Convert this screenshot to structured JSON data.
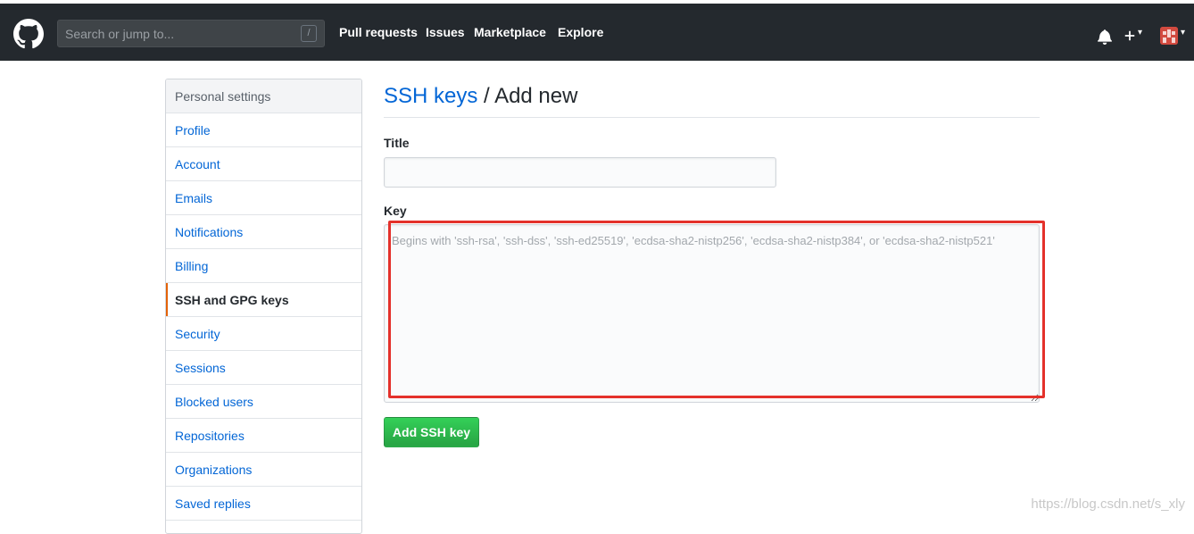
{
  "header": {
    "search_placeholder": "Search or jump to...",
    "search_shortcut": "/",
    "nav": [
      "Pull requests",
      "Issues",
      "Marketplace",
      "Explore"
    ],
    "plus_caret": "▾",
    "avatar_caret": "▾"
  },
  "sidebar": {
    "header": "Personal settings",
    "items": [
      {
        "label": "Profile"
      },
      {
        "label": "Account"
      },
      {
        "label": "Emails"
      },
      {
        "label": "Notifications"
      },
      {
        "label": "Billing"
      },
      {
        "label": "SSH and GPG keys",
        "selected": true
      },
      {
        "label": "Security"
      },
      {
        "label": "Sessions"
      },
      {
        "label": "Blocked users"
      },
      {
        "label": "Repositories"
      },
      {
        "label": "Organizations"
      },
      {
        "label": "Saved replies"
      }
    ]
  },
  "main": {
    "breadcrumb_link": "SSH keys",
    "breadcrumb_separator": "/",
    "breadcrumb_current": "Add new",
    "title_label": "Title",
    "title_value": "",
    "key_label": "Key",
    "key_value": "",
    "key_placeholder": "Begins with 'ssh-rsa', 'ssh-dss', 'ssh-ed25519', 'ecdsa-sha2-nistp256', 'ecdsa-sha2-nistp384', or 'ecdsa-sha2-nistp521'",
    "submit_label": "Add SSH key"
  },
  "watermark": "https://blog.csdn.net/s_xly",
  "colors": {
    "header_bg": "#24292e",
    "link": "#0366d6",
    "selected_marker": "#e36209",
    "button_green": "#28a745",
    "highlight_red": "#e4312b"
  },
  "icons": {
    "logo": "github-mark-icon",
    "bell": "bell-icon",
    "plus": "plus-icon",
    "avatar": "avatar"
  }
}
